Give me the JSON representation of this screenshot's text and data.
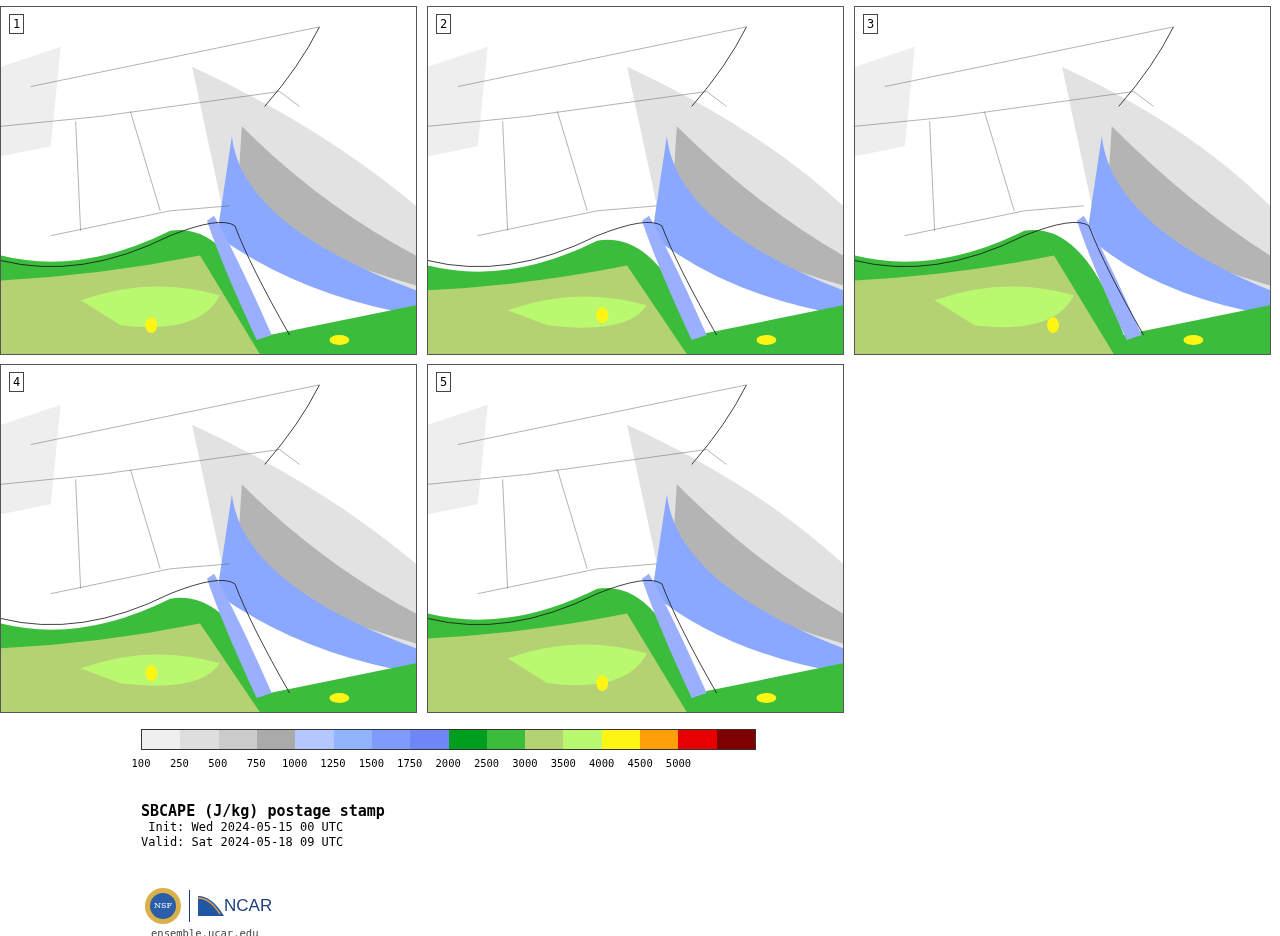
{
  "panels": [
    {
      "label": "1"
    },
    {
      "label": "2"
    },
    {
      "label": "3"
    },
    {
      "label": "4"
    },
    {
      "label": "5"
    }
  ],
  "colorbar": {
    "bins": [
      {
        "label": "100",
        "color": "#efefef"
      },
      {
        "label": "250",
        "color": "#dedede"
      },
      {
        "label": "500",
        "color": "#cbcbcb"
      },
      {
        "label": "750",
        "color": "#aaaaaa"
      },
      {
        "label": "1000",
        "color": "#b4c8ff"
      },
      {
        "label": "1250",
        "color": "#91b4ff"
      },
      {
        "label": "1500",
        "color": "#7f9bff"
      },
      {
        "label": "1750",
        "color": "#6f86f7"
      },
      {
        "label": "2000",
        "color": "#009e1e"
      },
      {
        "label": "2500",
        "color": "#3cbc3c"
      },
      {
        "label": "3000",
        "color": "#b4d274"
      },
      {
        "label": "3500",
        "color": "#baf870"
      },
      {
        "label": "4000",
        "color": "#fff514"
      },
      {
        "label": "4500",
        "color": "#ffa00a"
      },
      {
        "label": "5000",
        "color": "#e60000"
      },
      {
        "color": "#7f0000"
      }
    ]
  },
  "title": "SBCAPE (J/kg) postage stamp",
  "init": " Init: Wed 2024-05-15 00 UTC",
  "valid": "Valid: Sat 2024-05-18 09 UTC",
  "logos": {
    "seal": "NSF",
    "wordmark": "NCAR"
  },
  "site": "ensemble.ucar.edu"
}
